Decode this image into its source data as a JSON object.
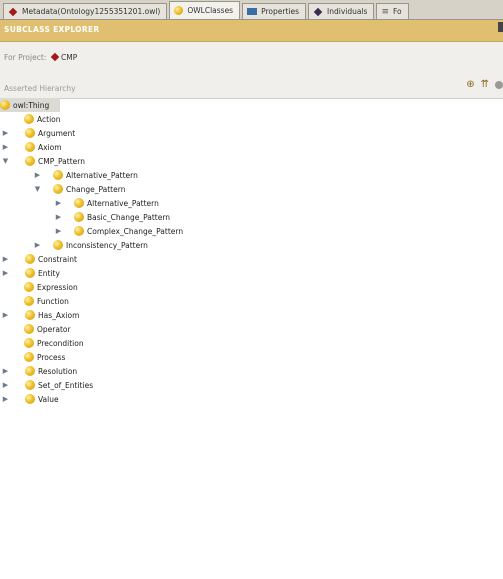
{
  "tabs": [
    {
      "label": "Metadata(Ontology1255351201.owl)",
      "icon": "diamond-icon"
    },
    {
      "label": "OWLClasses",
      "icon": "class-icon",
      "active": true
    },
    {
      "label": "Properties",
      "icon": "property-icon"
    },
    {
      "label": "Individuals",
      "icon": "individual-icon"
    },
    {
      "label": "Fo",
      "icon": "forms-icon"
    }
  ],
  "panel": {
    "title": "SUBCLASS EXPLORER",
    "project_label": "For Project:",
    "project_name": "CMP",
    "hierarchy_label": "Asserted Hierarchy"
  },
  "tree": [
    {
      "label": "owl:Thing",
      "toggle": "",
      "depth": 0
    },
    {
      "label": "Action",
      "toggle": "",
      "depth": 1
    },
    {
      "label": "Argument",
      "toggle": "▶",
      "depth": 1
    },
    {
      "label": "Axiom",
      "toggle": "▶",
      "depth": 1
    },
    {
      "label": "CMP_Pattern",
      "toggle": "▼",
      "depth": 1
    },
    {
      "label": "Alternative_Pattern",
      "toggle": "▶",
      "depth": 2
    },
    {
      "label": "Change_Pattern",
      "toggle": "▼",
      "depth": 2
    },
    {
      "label": "Alternative_Pattern",
      "toggle": "▶",
      "depth": 3
    },
    {
      "label": "Basic_Change_Pattern",
      "toggle": "▶",
      "depth": 3
    },
    {
      "label": "Complex_Change_Pattern",
      "toggle": "▶",
      "depth": 3
    },
    {
      "label": "Inconsistency_Pattern",
      "toggle": "▶",
      "depth": 2
    },
    {
      "label": "Constraint",
      "toggle": "▶",
      "depth": 1
    },
    {
      "label": "Entity",
      "toggle": "▶",
      "depth": 1
    },
    {
      "label": "Expression",
      "toggle": "",
      "depth": 1
    },
    {
      "label": "Function",
      "toggle": "",
      "depth": 1
    },
    {
      "label": "Has_Axiom",
      "toggle": "▶",
      "depth": 1
    },
    {
      "label": "Operator",
      "toggle": "",
      "depth": 1
    },
    {
      "label": "Precondition",
      "toggle": "",
      "depth": 1
    },
    {
      "label": "Process",
      "toggle": "",
      "depth": 1
    },
    {
      "label": "Resolution",
      "toggle": "▶",
      "depth": 1
    },
    {
      "label": "Set_of_Entities",
      "toggle": "▶",
      "depth": 1
    },
    {
      "label": "Value",
      "toggle": "▶",
      "depth": 1
    }
  ]
}
